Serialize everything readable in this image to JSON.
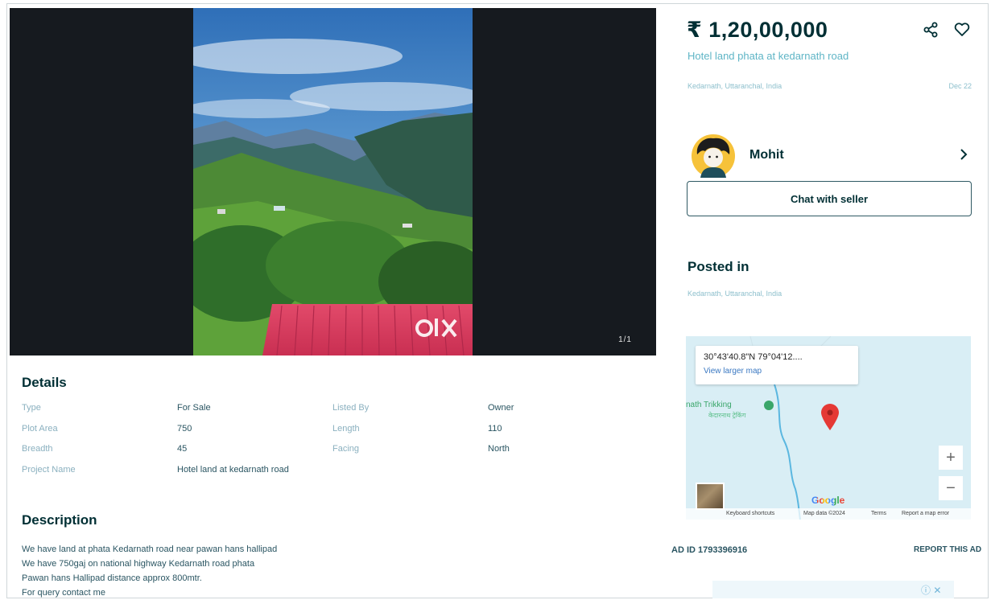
{
  "listing": {
    "price": "₹ 1,20,00,000",
    "title": "Hotel land phata at kedarnath road",
    "location": "Kedarnath, Uttaranchal, India",
    "date": "Dec 22",
    "image_counter": "1/1",
    "watermark": "OLX"
  },
  "seller": {
    "name": "Mohit",
    "chat_label": "Chat with seller"
  },
  "posted_in": {
    "heading": "Posted in",
    "location": "Kedarnath, Uttaranchal, India"
  },
  "map": {
    "coords": "30°43'40.8\"N 79°04'12....",
    "larger_map": "View larger map",
    "place_label": "nath Trikking",
    "place_sub": "केदारनाथ ट्रेकिंग",
    "zoom_in": "+",
    "zoom_out": "−",
    "google": "Google",
    "footer": {
      "shortcuts": "Keyboard shortcuts",
      "data": "Map data ©2024",
      "terms": "Terms",
      "report": "Report a map error"
    }
  },
  "details": {
    "heading": "Details",
    "rows": [
      {
        "k1": "Type",
        "v1": "For Sale",
        "k2": "Listed By",
        "v2": "Owner"
      },
      {
        "k1": "Plot Area",
        "v1": "750",
        "k2": "Length",
        "v2": "110"
      },
      {
        "k1": "Breadth",
        "v1": "45",
        "k2": "Facing",
        "v2": "North"
      },
      {
        "k1": "Project Name",
        "v1": "Hotel land at kedarnath road",
        "k2": "",
        "v2": ""
      }
    ]
  },
  "description": {
    "heading": "Description",
    "lines": [
      "We have land at phata Kedarnath road near pawan hans hallipad",
      "We have 750gaj on national highway Kedarnath road phata",
      "Pawan hans Hallipad distance approx 800mtr.",
      "For query contact me"
    ]
  },
  "footer": {
    "ad_id": "AD ID 1793396916",
    "report": "REPORT THIS AD"
  },
  "colors": {
    "primary_text": "#002f34",
    "link_teal": "#5fb5c6",
    "map_pin": "#e53935"
  }
}
